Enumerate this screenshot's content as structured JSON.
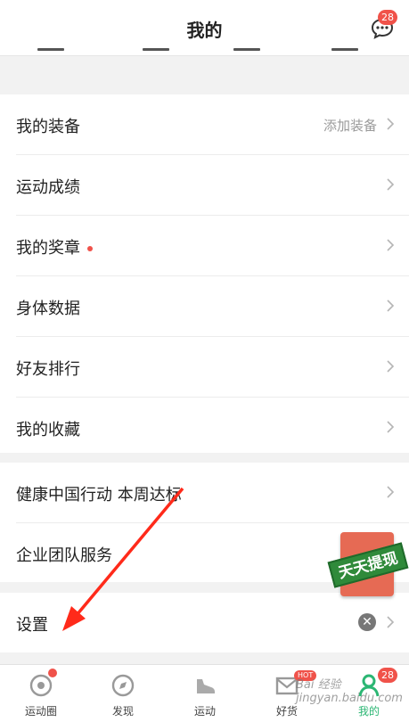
{
  "header": {
    "title": "我的",
    "message_badge": "28"
  },
  "sections": [
    {
      "rows": [
        {
          "label": "我的装备",
          "sub": "添加装备"
        },
        {
          "label": "运动成绩"
        },
        {
          "label": "我的奖章",
          "dot": true
        },
        {
          "label": "身体数据"
        },
        {
          "label": "好友排行"
        },
        {
          "label": "我的收藏"
        }
      ]
    },
    {
      "rows": [
        {
          "label": "健康中国行动 本周达标"
        },
        {
          "label": "企业团队服务"
        }
      ]
    },
    {
      "rows": [
        {
          "label": "设置"
        }
      ]
    }
  ],
  "promo": {
    "text": "天天提现"
  },
  "tabbar": {
    "tabs": [
      {
        "label": "运动圈",
        "icon": "target-icon"
      },
      {
        "label": "发现",
        "icon": "compass-icon"
      },
      {
        "label": "运动",
        "icon": "shoe-icon"
      },
      {
        "label": "好货",
        "icon": "mail-icon",
        "badge": "HOT"
      },
      {
        "label": "我的",
        "icon": "person-icon",
        "badge": "28",
        "active": true
      }
    ]
  },
  "colors": {
    "accent": "#2bb673",
    "badge": "#f0524a",
    "arrow": "#ff2a1a"
  },
  "watermark": "Bai 经验 jingyan.baidu.com"
}
